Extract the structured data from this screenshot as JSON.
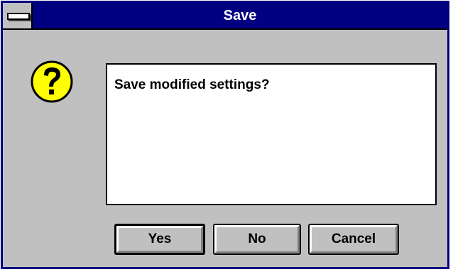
{
  "window": {
    "title": "Save"
  },
  "dialog": {
    "icon": "question-mark-icon",
    "message": "Save modified settings?"
  },
  "buttons": {
    "yes_label": "Yes",
    "no_label": "No",
    "cancel_label": "Cancel"
  },
  "colors": {
    "titlebar": "#000080",
    "window_face": "#c0c0c0",
    "icon_fill": "#ffff00"
  }
}
